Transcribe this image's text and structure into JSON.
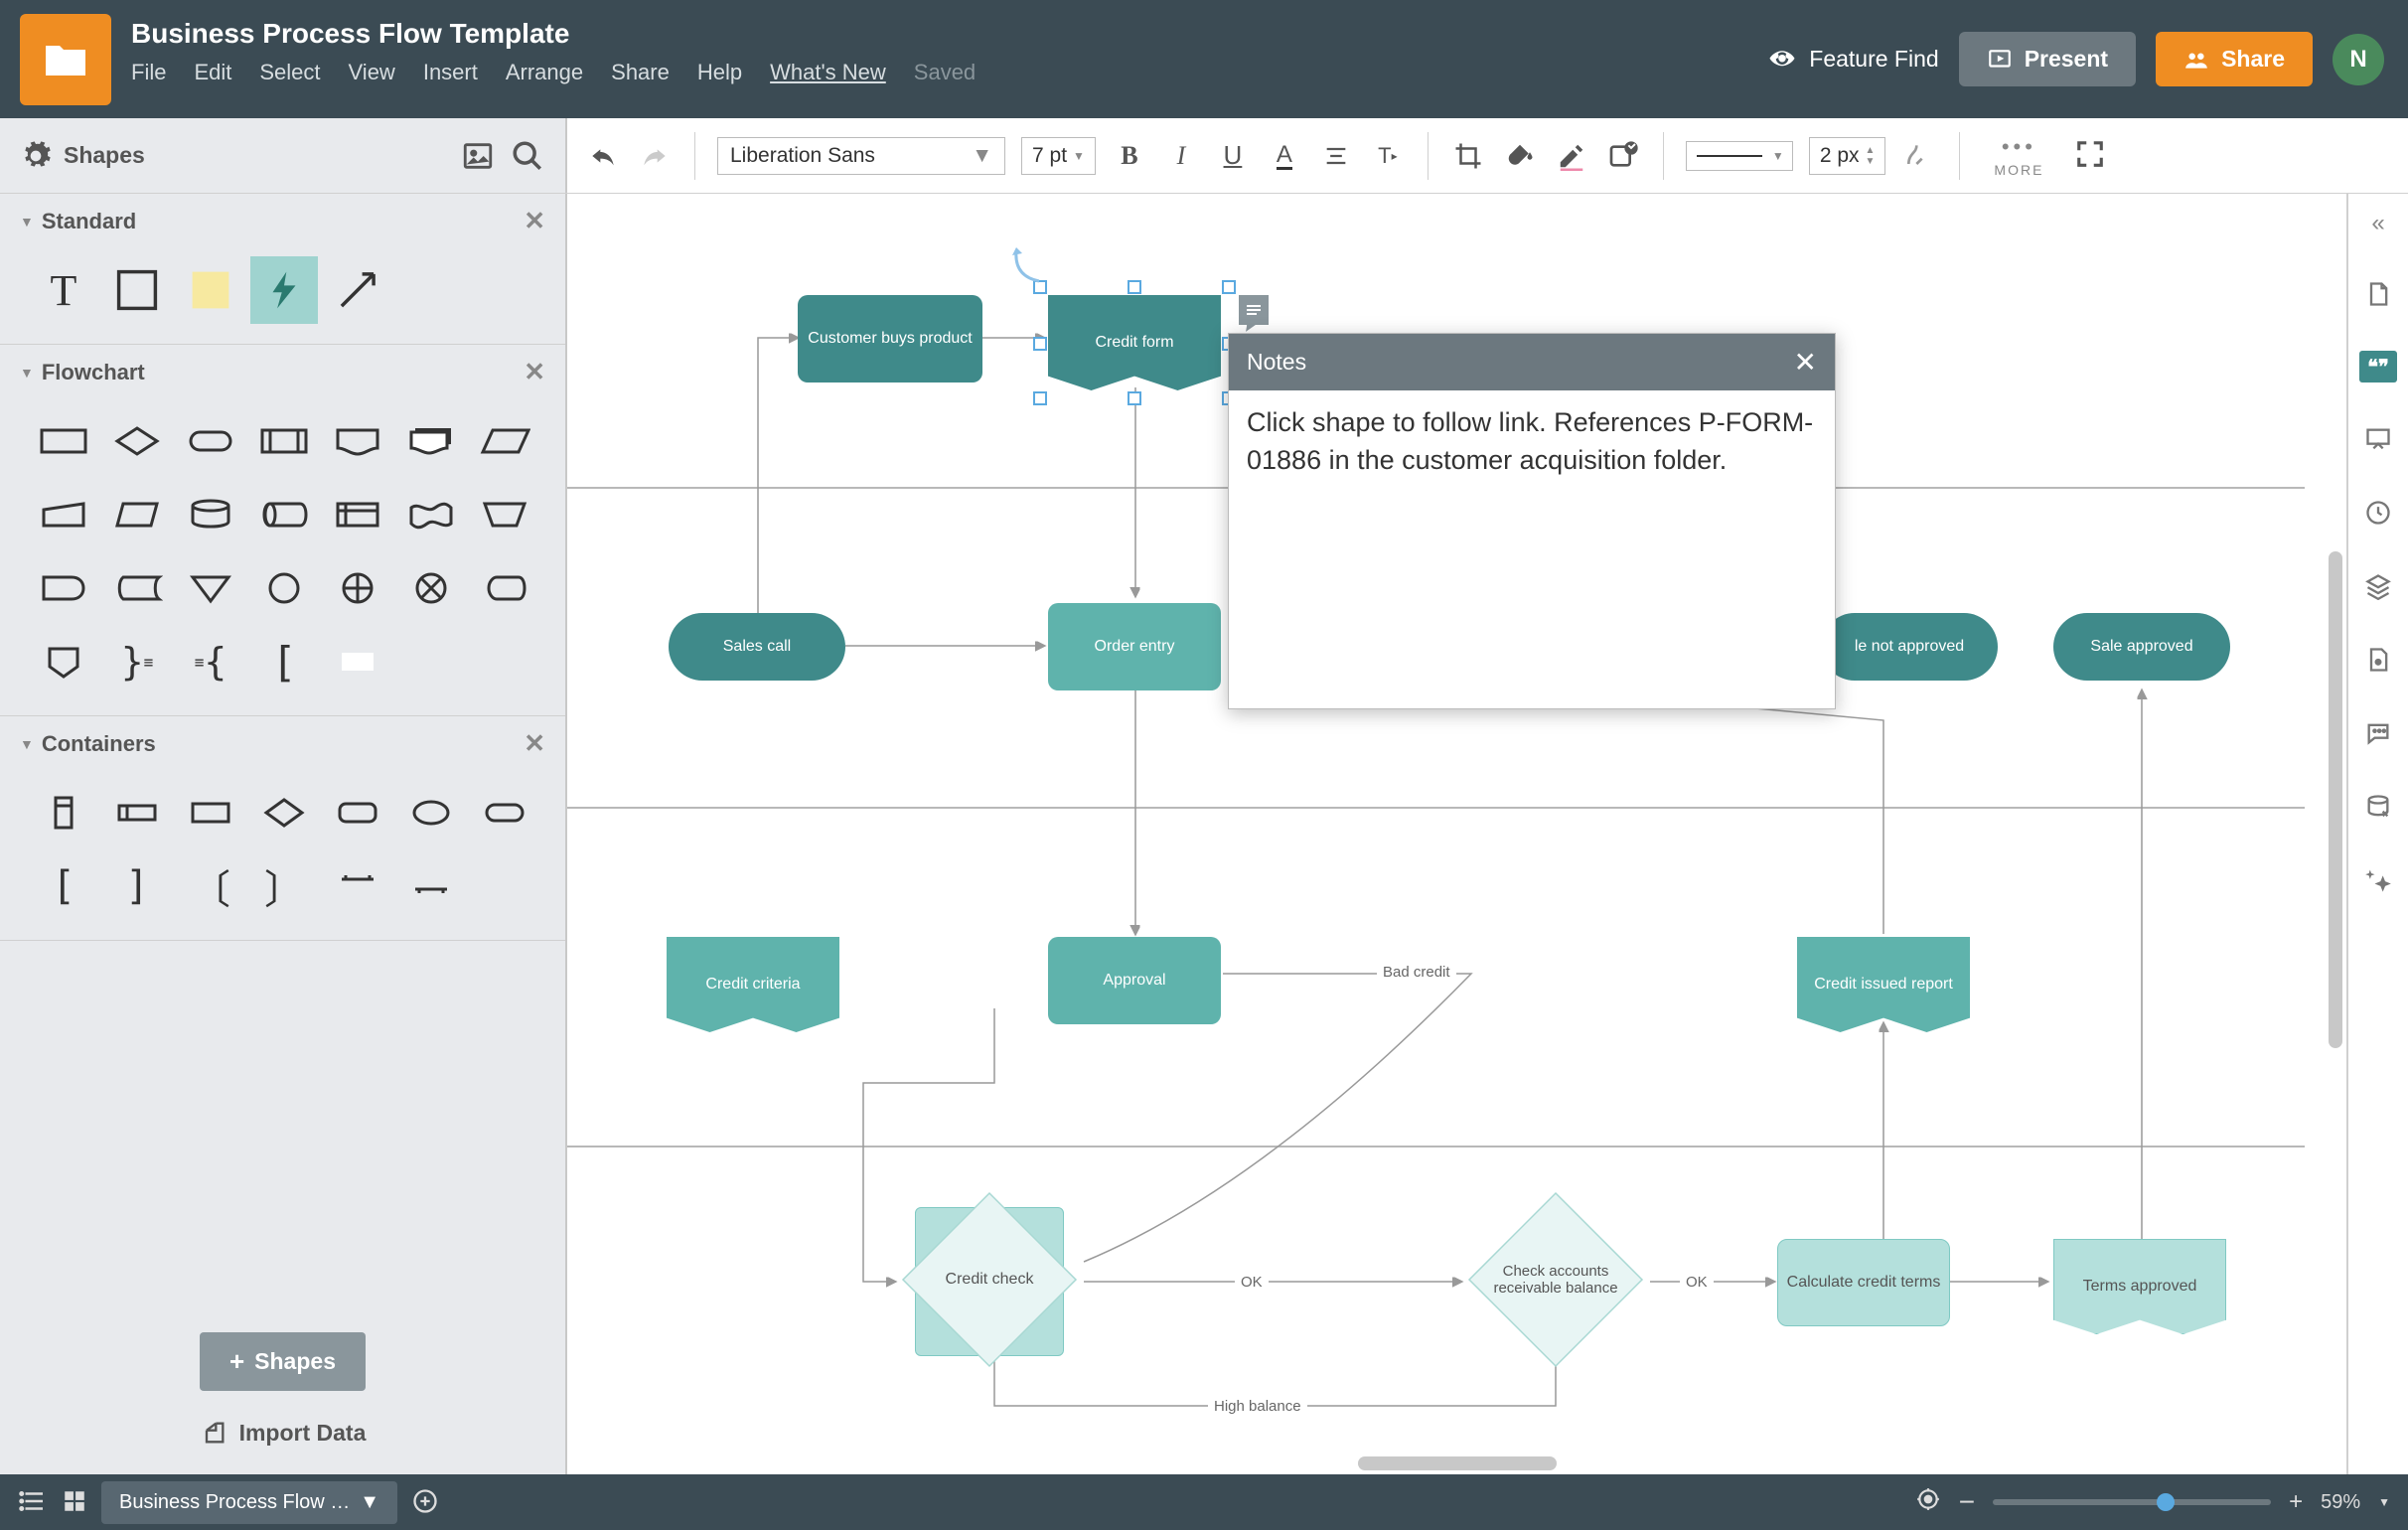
{
  "header": {
    "doc_title": "Business Process Flow Template",
    "menu": [
      "File",
      "Edit",
      "Select",
      "View",
      "Insert",
      "Arrange",
      "Share",
      "Help",
      "What's New"
    ],
    "saved_label": "Saved",
    "feature_find": "Feature Find",
    "present": "Present",
    "share": "Share",
    "avatar_letter": "N"
  },
  "toolbar": {
    "shapes_label": "Shapes",
    "font_family": "Liberation Sans",
    "font_size": "7 pt",
    "stroke_width": "2 px",
    "more_label": "MORE"
  },
  "panels": {
    "standard": {
      "title": "Standard"
    },
    "flowchart": {
      "title": "Flowchart"
    },
    "containers": {
      "title": "Containers"
    },
    "shapes_button": "Shapes",
    "import_data": "Import Data"
  },
  "notes_popup": {
    "title": "Notes",
    "body": "Click shape to follow link. References P-FORM-01886 in the customer acquisition folder."
  },
  "flow": {
    "customer_buys": "Customer buys product",
    "credit_form": "Credit form",
    "sales_call": "Sales call",
    "order_entry": "Order entry",
    "sale_not_approved": "le not approved",
    "sale_approved": "Sale approved",
    "credit_criteria": "Credit criteria",
    "approval": "Approval",
    "bad_credit_label": "Bad credit",
    "credit_issued": "Credit issued report",
    "credit_check": "Credit check",
    "check_accounts": "Check accounts receivable balance",
    "calculate_credit": "Calculate credit terms",
    "terms_approved": "Terms approved",
    "ok_label": "OK",
    "high_balance_label": "High balance"
  },
  "footer": {
    "page_tab": "Business Process Flow …",
    "zoom_pct": "59%"
  }
}
